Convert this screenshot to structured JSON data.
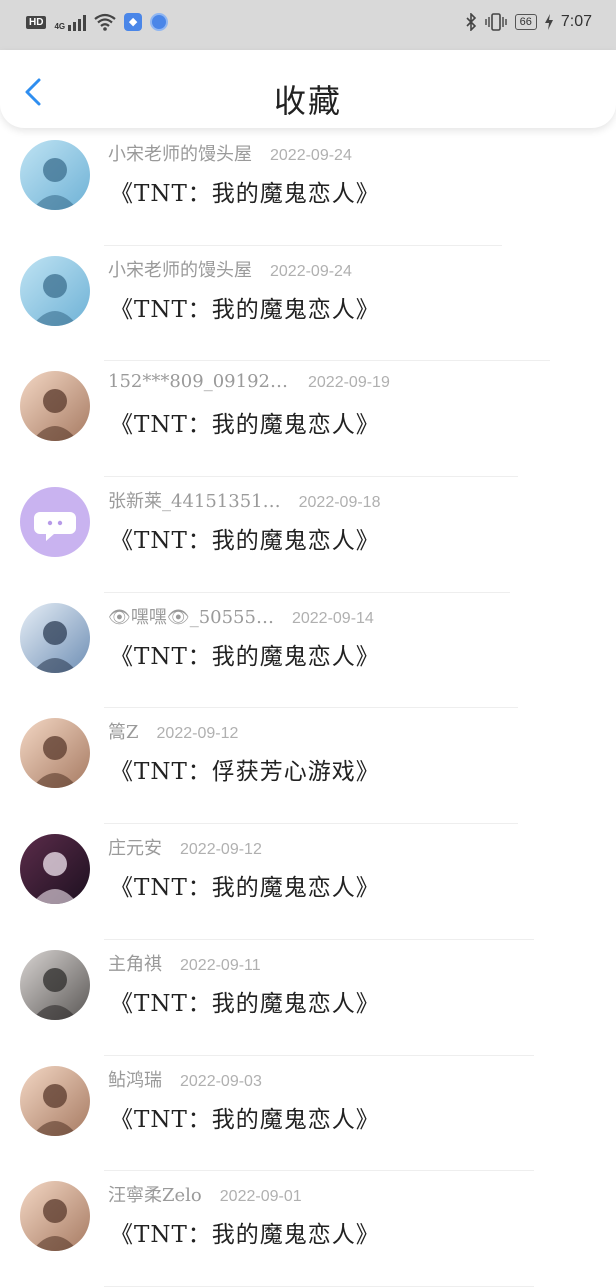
{
  "status_bar": {
    "hd": "HD",
    "net": "4G",
    "battery": "66",
    "time": "7:07",
    "icons": [
      "hd-badge-icon",
      "signal-icon",
      "wifi-icon",
      "shield-app-icon",
      "browser-app-icon",
      "bluetooth-icon",
      "vibrate-icon",
      "battery-icon",
      "charging-icon"
    ]
  },
  "header": {
    "title": "收藏",
    "back_icon": "chevron-left-icon",
    "accent": "#2f8ef0"
  },
  "items": [
    {
      "user": "小宋老师的馒头屋",
      "date": "2022-09-24",
      "title": "《TNT：我的魔鬼恋人》",
      "avatar": "group-photo-avatar"
    },
    {
      "user": "小宋老师的馒头屋",
      "date": "2022-09-24",
      "title": "《TNT：我的魔鬼恋人》",
      "avatar": "group-photo-avatar"
    },
    {
      "user": "152***809_091925…",
      "date": "2022-09-19",
      "title": "《TNT：我的魔鬼恋人》",
      "avatar": "girl-photo-avatar"
    },
    {
      "user": "张新莱_44151351…",
      "date": "2022-09-18",
      "title": "《TNT：我的魔鬼恋人》",
      "avatar": "default-chat-avatar"
    },
    {
      "user": "👁嘿嘿👁_50555…",
      "date": "2022-09-14",
      "title": "《TNT：我的魔鬼恋人》",
      "avatar": "couple-photo-avatar"
    },
    {
      "user": "篙Z",
      "date": "2022-09-12",
      "title": "《TNT：俘获芳心游戏》",
      "avatar": "girl-photo-avatar"
    },
    {
      "user": "庄元安",
      "date": "2022-09-12",
      "title": "《TNT：我的魔鬼恋人》",
      "avatar": "anime-photo-avatar"
    },
    {
      "user": "主角祺",
      "date": "2022-09-11",
      "title": "《TNT：我的魔鬼恋人》",
      "avatar": "boy-photo-avatar"
    },
    {
      "user": "鲇鸿瑞",
      "date": "2022-09-03",
      "title": "《TNT：我的魔鬼恋人》",
      "avatar": "girl-photo-avatar"
    },
    {
      "user": "汪寧柔Zelo",
      "date": "2022-09-01",
      "title": "《TNT：我的魔鬼恋人》",
      "avatar": "girl-photo-avatar"
    }
  ]
}
